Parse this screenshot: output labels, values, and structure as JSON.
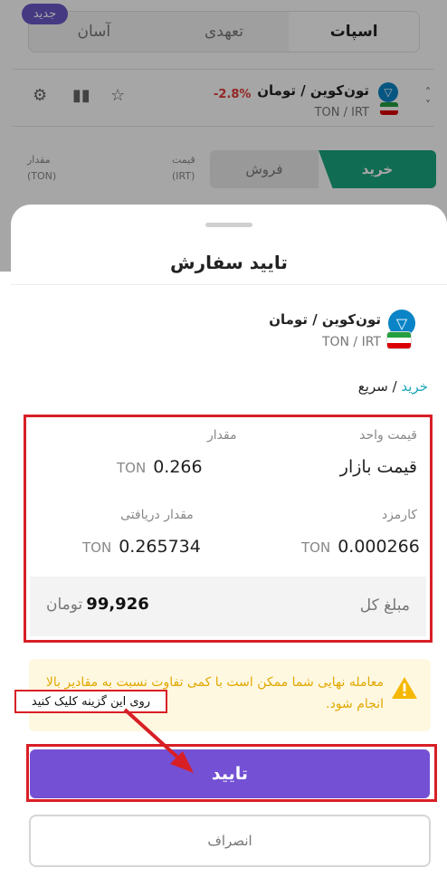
{
  "tabs": [
    {
      "label": "اسپات"
    },
    {
      "label": "تعهدی"
    },
    {
      "label": "آسان"
    }
  ],
  "new_badge": "جدید",
  "market": {
    "pair_name": "تون‌کوین / تومان",
    "pair_symbol": "TON / IRT",
    "change": "-2.8%",
    "change_color": "#e23b3b",
    "icons": [
      "settings-icon",
      "candles-icon",
      "star-icon",
      "chevron-icon"
    ]
  },
  "trade_panel": {
    "amount_label": "مقدار",
    "amount_unit": "(TON)",
    "price_label": "قیمت",
    "price_unit": "(IRT)",
    "buy": "خرید",
    "sell": "فروش"
  },
  "sheet": {
    "title": "تایید سفارش",
    "pair_name": "تون‌کوین / تومان",
    "pair_symbol": "TON / IRT",
    "order_buy": "خرید",
    "order_sep": " / ",
    "order_mode": "سریع",
    "unit_price_label": "قیمت واحد",
    "unit_price_value": "قیمت بازار",
    "amount_label": "مقدار",
    "amount_value": "0.266",
    "amount_unit": "TON",
    "fee_label": "کارمزد",
    "fee_value": "0.000266",
    "fee_unit": "TON",
    "received_label": "مقدار دریافتی",
    "received_value": "0.265734",
    "received_unit": "TON",
    "total_label": "مبلغ کل",
    "total_value": "99,926",
    "total_unit": "تومان",
    "warning": "معامله نهایی شما ممکن است با کمی تفاوت نسبت به مقادیر بالا انجام شود.",
    "confirm": "تایید",
    "cancel": "انصراف"
  },
  "annotation": {
    "hint": "روی این گزینه کلیک کنید",
    "highlight_color": "#d81f26"
  },
  "colors": {
    "brand_purple": "#7450d4",
    "buy_green": "#1aa67e",
    "warning_yellow": "#e0a800"
  }
}
